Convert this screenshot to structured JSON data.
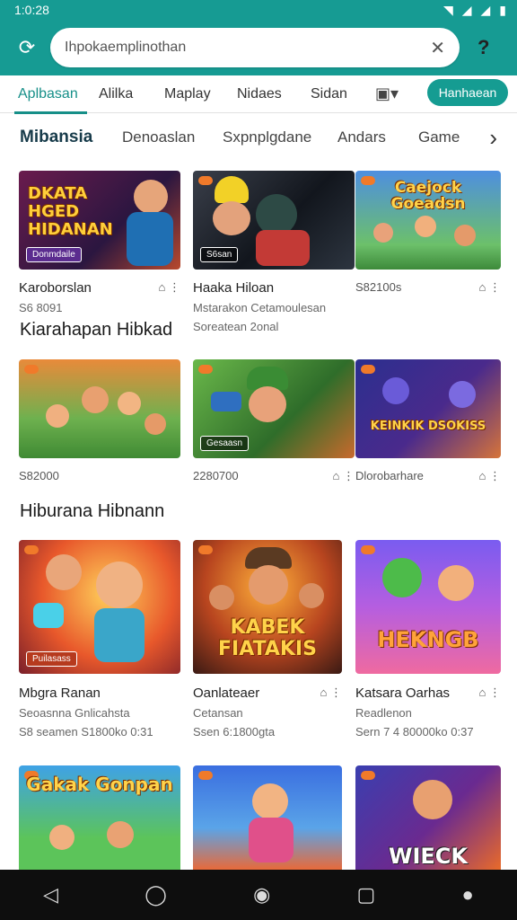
{
  "status": {
    "time": "1:0:28",
    "icons": [
      "wifi-icon",
      "signal-icon",
      "signal-icon",
      "battery-icon"
    ]
  },
  "search": {
    "value": "Ihpokaemplinothan"
  },
  "tabs": {
    "items": [
      "Aplbasan",
      "Alilka",
      "Maplay",
      "Nidaes",
      "Sidan"
    ],
    "button": "Hanhaean"
  },
  "subtabs": {
    "items": [
      "Mibansia",
      "Denoaslan",
      "Sxpnplgdane",
      "Andars",
      "Game"
    ]
  },
  "sections": {
    "row2_title": "Kiarahapan  Hibkad",
    "row3_title": "Hiburana Hibnann"
  },
  "cards": [
    {
      "name": "Karoborslan",
      "sub": "S6 8091",
      "info": "",
      "badge": "Donmdaile",
      "big": "DKATA HGED HIDANAN"
    },
    {
      "name": "Haaka Hiloan",
      "sub": "Mstarakon Cetamoulesan",
      "info": "Soreatean  2onal",
      "badge": "S6san",
      "big": ""
    },
    {
      "name": "S82100s",
      "sub": "",
      "info": "",
      "badge": "",
      "big": "Caejock Goeadsn"
    },
    {
      "name": "S82000",
      "sub": "",
      "info": "",
      "badge": "",
      "big": ""
    },
    {
      "name": "2280700",
      "sub": "",
      "info": "",
      "badge": "Gesaasn",
      "big": ""
    },
    {
      "name": "Dlorobarhare",
      "sub": "",
      "info": "",
      "badge": "",
      "big": "KEINKIK DSOKISS"
    },
    {
      "name": "Mbgra Ranan",
      "sub": "Seoasnna Gnlicahsta",
      "info": "S8 seamen  S1800ko 0:31",
      "badge": "Puilasass",
      "big": ""
    },
    {
      "name": "Oanlateaer",
      "sub": "Cetansan",
      "info": "Ssen  6:1800gta",
      "badge": "",
      "big": "KABEK FIATAKIS"
    },
    {
      "name": "Katsara Oarhas",
      "sub": "Readlenon",
      "info": "Sern  7 4 80000ko 0:37",
      "badge": "",
      "big": "HEKNGB"
    },
    {
      "name": "",
      "sub": "",
      "info": "",
      "badge": "",
      "big": "Gakak Gonpan"
    },
    {
      "name": "",
      "sub": "",
      "info": "",
      "badge": "",
      "big": ""
    },
    {
      "name": "",
      "sub": "",
      "info": "",
      "badge": "",
      "big": "WIECK"
    }
  ],
  "colors": {
    "accent": "#169b93",
    "nav": "#0e0e0e"
  }
}
